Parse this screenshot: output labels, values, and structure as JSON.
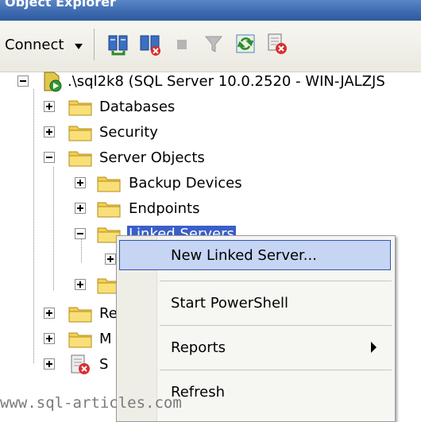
{
  "window": {
    "title": "Object Explorer"
  },
  "toolbar": {
    "connect_label": "Connect"
  },
  "tree": {
    "root": ".\\sql2k8 (SQL Server 10.0.2520 - WIN-JALZJS",
    "databases": "Databases",
    "security": "Security",
    "server_objects": "Server Objects",
    "backup_devices": "Backup Devices",
    "endpoints": "Endpoints",
    "linked_servers": "Linked Servers",
    "replication_partial": "Re",
    "management_partial": "M",
    "sql_agent_partial": "S"
  },
  "context_menu": {
    "items": [
      {
        "label": "New Linked Server..."
      },
      {
        "label": "Start PowerShell"
      },
      {
        "label": "Reports"
      },
      {
        "label": "Refresh"
      }
    ]
  },
  "watermark": "www.sql-articles.com"
}
